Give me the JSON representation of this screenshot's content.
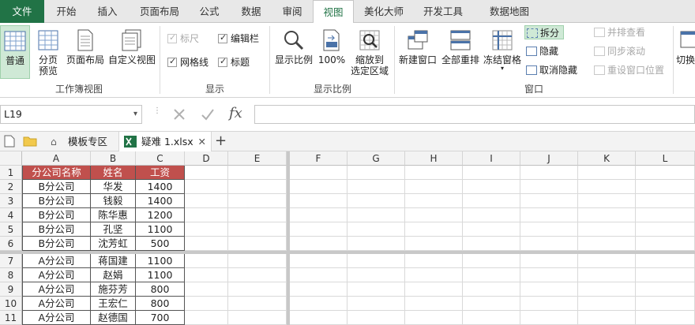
{
  "ribbon_tabs": [
    {
      "label": "文件"
    },
    {
      "label": "开始"
    },
    {
      "label": "插入"
    },
    {
      "label": "页面布局"
    },
    {
      "label": "公式"
    },
    {
      "label": "数据"
    },
    {
      "label": "审阅"
    },
    {
      "label": "视图"
    },
    {
      "label": "美化大师"
    },
    {
      "label": "开发工具"
    },
    {
      "label": "数据地图"
    }
  ],
  "groups": {
    "workbook_views": {
      "label": "工作簿视图",
      "normal": "普通",
      "page_break_line1": "分页",
      "page_break_line2": "预览",
      "page_layout": "页面布局",
      "custom_views": "自定义视图"
    },
    "show": {
      "label": "显示",
      "ruler": "标尺",
      "gridlines": "网格线",
      "formula_bar": "编辑栏",
      "headings": "标题"
    },
    "zoom": {
      "label": "显示比例",
      "zoom": "显示比例",
      "hundred": "100%",
      "zoom_sel_line1": "缩放到",
      "zoom_sel_line2": "选定区域"
    },
    "window": {
      "label": "窗口",
      "new_window": "新建窗口",
      "arrange_all": "全部重排",
      "freeze_panes": "冻结窗格",
      "split": "拆分",
      "hide": "隐藏",
      "unhide": "取消隐藏",
      "side_by_side": "并排查看",
      "sync_scroll": "同步滚动",
      "reset_pos": "重设窗口位置",
      "switch": "切换"
    }
  },
  "formula_bar": {
    "name_box": "L19",
    "fx": "fx"
  },
  "workbook_tabs": {
    "template": "模板专区",
    "file": "疑难 1.xlsx",
    "add": "+"
  },
  "columns": [
    "A",
    "B",
    "C",
    "D",
    "E",
    "F",
    "G",
    "H",
    "I",
    "J",
    "K",
    "L"
  ],
  "rows": [
    {
      "n": "1",
      "a": "分公司名称",
      "b": "姓名",
      "c": "工资"
    },
    {
      "n": "2",
      "a": "B分公司",
      "b": "华发",
      "c": "1400"
    },
    {
      "n": "3",
      "a": "B分公司",
      "b": "钱毅",
      "c": "1400"
    },
    {
      "n": "4",
      "a": "B分公司",
      "b": "陈华惠",
      "c": "1200"
    },
    {
      "n": "5",
      "a": "B分公司",
      "b": "孔坚",
      "c": "1100"
    },
    {
      "n": "6",
      "a": "B分公司",
      "b": "沈芳虹",
      "c": "500"
    },
    {
      "n": "7",
      "a": "A分公司",
      "b": "蒋国建",
      "c": "1100"
    },
    {
      "n": "8",
      "a": "A分公司",
      "b": "赵娟",
      "c": "1100"
    },
    {
      "n": "9",
      "a": "A分公司",
      "b": "施芬芳",
      "c": "800"
    },
    {
      "n": "10",
      "a": "A分公司",
      "b": "王宏仁",
      "c": "800"
    },
    {
      "n": "11",
      "a": "A分公司",
      "b": "赵德国",
      "c": "700"
    }
  ],
  "colors": {
    "accent": "#217346",
    "header_fill": "#c0504d",
    "selected_fill": "#cfe9d6"
  }
}
